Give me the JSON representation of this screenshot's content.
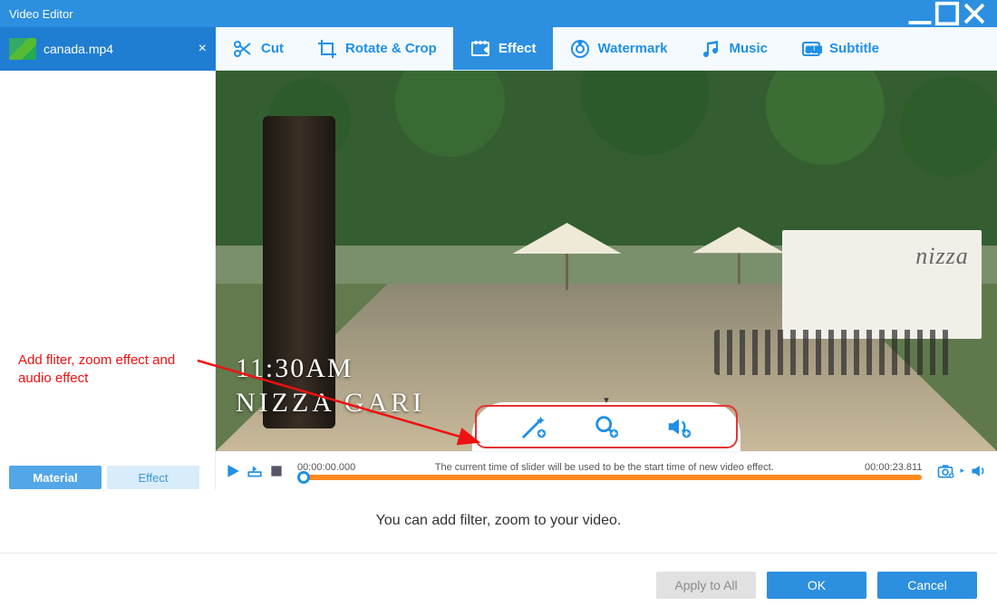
{
  "window": {
    "title": "Video Editor"
  },
  "file_tab": {
    "name": "canada.mp4"
  },
  "tools": {
    "cut": "Cut",
    "rotate": "Rotate & Crop",
    "effect": "Effect",
    "watermark": "Watermark",
    "music": "Music",
    "subtitle": "Subtitle",
    "active": "effect"
  },
  "sidebar": {
    "tabs": {
      "material": "Material",
      "effect": "Effect",
      "active": "material"
    },
    "annotation": "Add fliter, zoom effect and audio effect"
  },
  "preview": {
    "overlay_time": "11:30AM",
    "overlay_place": "NIZZA GARI",
    "wall_brand": "nizza"
  },
  "effect_popup": {
    "buttons": [
      "filter",
      "zoom",
      "audio"
    ]
  },
  "playback": {
    "current_time": "00:00:00.000",
    "total_time": "00:00:23.811",
    "hint": "The current time of slider will be used to be the start time of new video effect."
  },
  "main_message": "You can add filter, zoom to your video.",
  "footer": {
    "apply_all": "Apply to All",
    "ok": "OK",
    "cancel": "Cancel"
  }
}
